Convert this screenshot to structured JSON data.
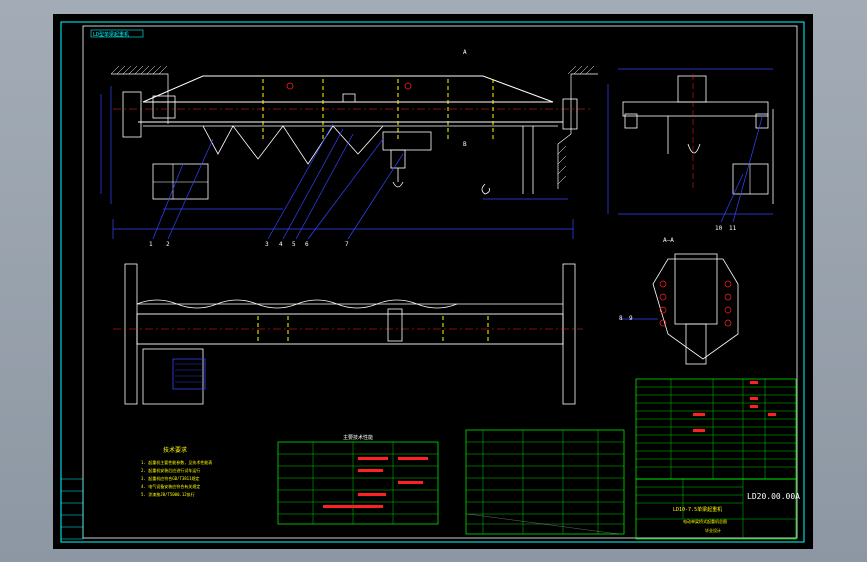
{
  "drawing": {
    "frame_tag": "LD型单梁起重机",
    "drawing_code": "LD20.00.00A",
    "section_label": "A—A",
    "mark_a": "A",
    "mark_b": "B",
    "part_callouts_front": [
      "1",
      "2",
      "3",
      "4",
      "5",
      "6",
      "7"
    ],
    "part_callouts_side": [
      "10",
      "11"
    ],
    "part_callouts_section": [
      "8",
      "9"
    ],
    "tech_title": "技术要求",
    "tech_lines": [
      "1. 起重机主要性能参数，见技术性能表",
      "2. 起重机安装后应进行试车运行",
      "3. 起重机应符合GB/T3811规定",
      "4. 电气设备安装应符合有关规定",
      "5. 涂漆按JB/T5000.12执行"
    ],
    "table_title": "主要技术性能",
    "titleblock_name": "LD10-7.5单梁起重机",
    "titleblock_sub": "电动单梁桥式起重机总图",
    "titleblock_school": "毕业设计"
  },
  "colors": {
    "background": "#000000",
    "white": "#ffffff",
    "yellow": "#ffff00",
    "red": "#ff2020",
    "cyan": "#00ffff",
    "green": "#00ff00",
    "blue": "#3344ff",
    "magenta": "#ff00ff"
  }
}
